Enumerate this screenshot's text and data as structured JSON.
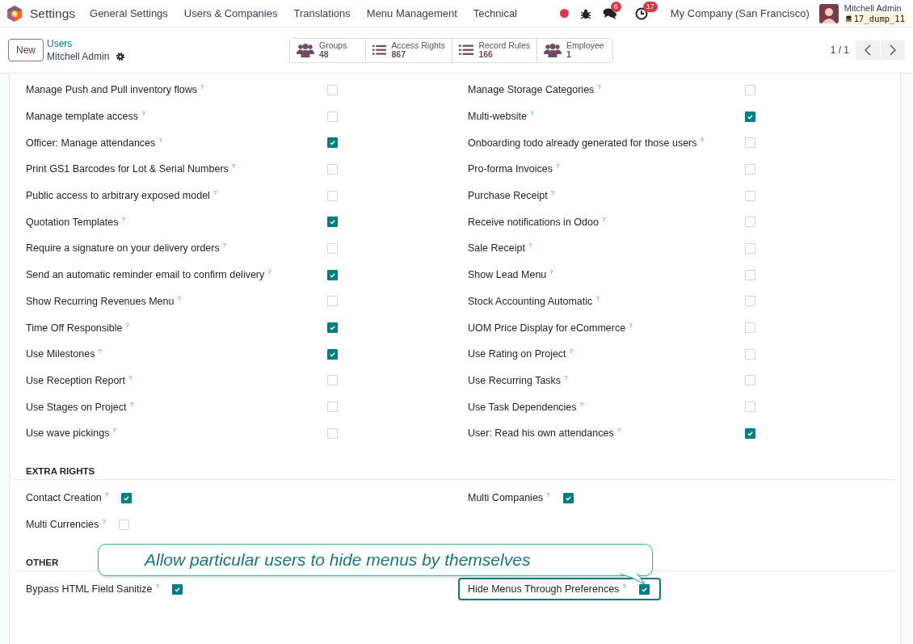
{
  "navbar": {
    "app_name": "Settings",
    "menus": [
      "General Settings",
      "Users & Companies",
      "Translations",
      "Menu Management",
      "Technical"
    ],
    "chat_badge": "6",
    "activity_badge": "17",
    "company": "My Company (San Francisco)",
    "user_name": "Mitchell Admin",
    "database": "17_dump_11"
  },
  "control_panel": {
    "new_button": "New",
    "breadcrumb": "Users",
    "record_title": "Mitchell Admin",
    "smart_buttons": [
      {
        "kind": "people",
        "label": "Groups",
        "count": "48"
      },
      {
        "kind": "list",
        "label": "Access Rights",
        "count": "867"
      },
      {
        "kind": "list",
        "label": "Record Rules",
        "count": "166"
      },
      {
        "kind": "people",
        "label": "Employee",
        "count": "1"
      }
    ],
    "pager": "1 / 1"
  },
  "permissions": [
    {
      "label": "Manage Push and Pull inventory flows",
      "help": "?",
      "checked": false
    },
    {
      "label": "Manage Storage Categories",
      "help": "?",
      "checked": false
    },
    {
      "label": "Manage template access",
      "help": "?",
      "checked": false
    },
    {
      "label": "Multi-website",
      "help": "?",
      "checked": true
    },
    {
      "label": "Officer: Manage attendances",
      "help": "?",
      "checked": true
    },
    {
      "label": "Onboarding todo already generated for those users",
      "help": "?",
      "checked": false
    },
    {
      "label": "Print GS1 Barcodes for Lot & Serial Numbers",
      "help": "?",
      "checked": false
    },
    {
      "label": "Pro-forma Invoices",
      "help": "?",
      "checked": false
    },
    {
      "label": "Public access to arbitrary exposed model",
      "help": "?",
      "checked": false
    },
    {
      "label": "Purchase Receipt",
      "help": "?",
      "checked": false
    },
    {
      "label": "Quotation Templates",
      "help": "?",
      "checked": true
    },
    {
      "label": "Receive notifications in Odoo",
      "help": "?",
      "checked": false
    },
    {
      "label": "Require a signature on your delivery orders",
      "help": "?",
      "checked": false
    },
    {
      "label": "Sale Receipt",
      "help": "?",
      "checked": false
    },
    {
      "label": "Send an automatic reminder email to confirm delivery",
      "help": "?",
      "checked": true
    },
    {
      "label": "Show Lead Menu",
      "help": "?",
      "checked": false
    },
    {
      "label": "Show Recurring Revenues Menu",
      "help": "?",
      "checked": false
    },
    {
      "label": "Stock Accounting Automatic",
      "help": "?",
      "checked": false
    },
    {
      "label": "Time Off Responsible",
      "help": "?",
      "checked": true
    },
    {
      "label": "UOM Price Display for eCommerce",
      "help": "?",
      "checked": false
    },
    {
      "label": "Use Milestones",
      "help": "?",
      "checked": true
    },
    {
      "label": "Use Rating on Project",
      "help": "?",
      "checked": false
    },
    {
      "label": "Use Reception Report",
      "help": "?",
      "checked": false
    },
    {
      "label": "Use Recurring Tasks",
      "help": "?",
      "checked": false
    },
    {
      "label": "Use Stages on Project",
      "help": "?",
      "checked": false
    },
    {
      "label": "Use Task Dependencies",
      "help": "?",
      "checked": false
    },
    {
      "label": "Use wave pickings",
      "help": "?",
      "checked": false
    },
    {
      "label": "User: Read his own attendances",
      "help": "?",
      "checked": true
    }
  ],
  "sections": [
    {
      "title": "EXTRA RIGHTS",
      "fields": [
        {
          "label": "Contact Creation",
          "help": "?",
          "checked": true,
          "highlighted": false
        },
        {
          "label": "Multi Companies",
          "help": "?",
          "checked": true,
          "highlighted": false
        },
        {
          "label": "Multi Currencies",
          "help": "?",
          "checked": false,
          "highlighted": false
        }
      ]
    },
    {
      "title": "OTHER",
      "fields": [
        {
          "label": "Bypass HTML Field Sanitize",
          "help": "?",
          "checked": true,
          "highlighted": false
        },
        {
          "label": "Hide Menus Through Preferences",
          "help": "?",
          "checked": true,
          "highlighted": true
        }
      ]
    }
  ],
  "callout": {
    "text": "Allow particular users to hide menus by themselves"
  }
}
